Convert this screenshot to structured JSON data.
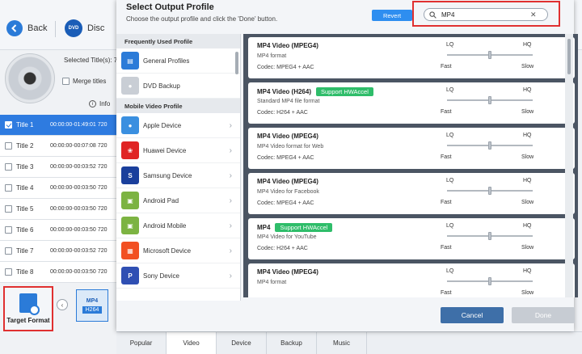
{
  "app": {
    "back_label": "Back",
    "disc_icon_text": "DVD",
    "disc_label": "Disc",
    "selected_titles": "Selected Title(s): 720",
    "merge_titles": "Merge titles",
    "info_label": "Info",
    "titles": [
      {
        "name": "Title 1",
        "time": "00:00:00-01:49:01",
        "extra": "720",
        "selected": true
      },
      {
        "name": "Title 2",
        "time": "00:00:00-00:07:08",
        "extra": "720",
        "selected": false
      },
      {
        "name": "Title 3",
        "time": "00:00:00-00:03:52",
        "extra": "720",
        "selected": false
      },
      {
        "name": "Title 4",
        "time": "00:00:00-00:03:50",
        "extra": "720",
        "selected": false
      },
      {
        "name": "Title 5",
        "time": "00:00:00-00:03:50",
        "extra": "720",
        "selected": false
      },
      {
        "name": "Title 6",
        "time": "00:00:00-00:03:50",
        "extra": "720",
        "selected": false
      },
      {
        "name": "Title 7",
        "time": "00:00:00-00:03:52",
        "extra": "720",
        "selected": false
      },
      {
        "name": "Title 8",
        "time": "00:00:00-00:03:50",
        "extra": "720",
        "selected": false
      }
    ],
    "target_format_label": "Target Format",
    "format_thumb": {
      "top": "MP4",
      "bottom": "H264"
    },
    "bottom_tabs": [
      "Popular",
      "Video",
      "Device",
      "Backup",
      "Music"
    ],
    "active_tab": "Video"
  },
  "dialog": {
    "title": "Select Output Profile",
    "subtitle": "Choose the output profile and click the 'Done' button.",
    "revert_label": "Revert",
    "search": {
      "value": "MP4",
      "placeholder": ""
    },
    "sections": {
      "frequent": "Frequently Used Profile",
      "mobile": "Mobile Video Profile"
    },
    "frequent_items": [
      {
        "label": "General Profiles",
        "icon": "monitor-icon"
      },
      {
        "label": "DVD Backup",
        "icon": "disc-icon"
      }
    ],
    "mobile_items": [
      {
        "label": "Apple Device",
        "icon": "apple-icon"
      },
      {
        "label": "Huawei Device",
        "icon": "huawei-icon"
      },
      {
        "label": "Samsung Device",
        "icon": "samsung-icon"
      },
      {
        "label": "Android Pad",
        "icon": "android-icon"
      },
      {
        "label": "Android Mobile",
        "icon": "android-icon"
      },
      {
        "label": "Microsoft Device",
        "icon": "windows-icon"
      },
      {
        "label": "Sony Device",
        "icon": "playstation-icon"
      }
    ],
    "profiles": [
      {
        "name": "MP4 Video (MPEG4)",
        "hw": "",
        "desc": "MP4 format",
        "codec": "Codec: MPEG4 + AAC"
      },
      {
        "name": "MP4 Video (H264)",
        "hw": "Support HWAccel",
        "desc": "Standard MP4 file format",
        "codec": "Codec: H264 + AAC"
      },
      {
        "name": "MP4 Video (MPEG4)",
        "hw": "",
        "desc": "MP4 Video format for Web",
        "codec": "Codec: MPEG4 + AAC"
      },
      {
        "name": "MP4 Video (MPEG4)",
        "hw": "",
        "desc": "MP4 Video for Facebook",
        "codec": "Codec: MPEG4 + AAC"
      },
      {
        "name": "MP4",
        "hw": "Support HWAccel",
        "desc": "MP4 Video for YouTube",
        "codec": "Codec: H264 + AAC"
      },
      {
        "name": "MP4 Video (MPEG4)",
        "hw": "",
        "desc": "MP4 format",
        "codec": ""
      }
    ],
    "quality": {
      "lq": "LQ",
      "hq": "HQ",
      "fast": "Fast",
      "slow": "Slow",
      "level": 0.5
    },
    "cancel_label": "Cancel",
    "done_label": "Done",
    "colors": {
      "accent": "#2e8ef0",
      "hw_badge": "#2fbd6a",
      "highlight": "#e03030"
    }
  }
}
